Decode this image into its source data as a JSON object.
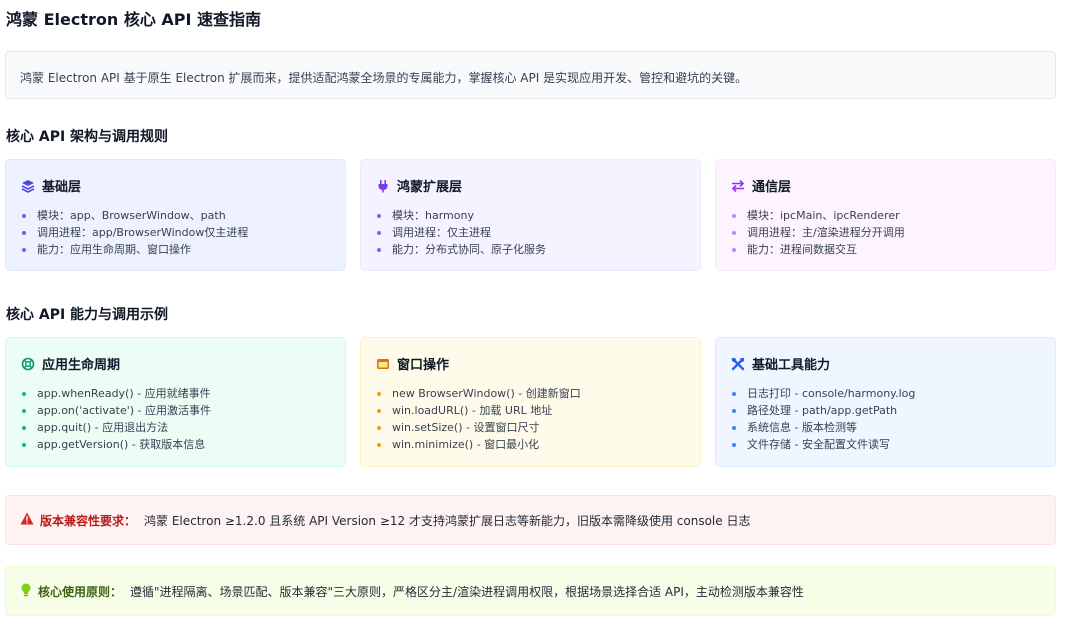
{
  "title": "鸿蒙 Electron 核心 API 速查指南",
  "intro": "鸿蒙 Electron API 基于原生 Electron 扩展而来，提供适配鸿蒙全场景的专属能力，掌握核心 API 是实现应用开发、管控和避坑的关键。",
  "sections": {
    "architecture": {
      "title": "核心 API 架构与调用规则",
      "cards": [
        {
          "title": "基础层",
          "icon": "layers-icon",
          "color": "#4f46e5",
          "items": [
            "模块：app、BrowserWindow、path",
            "调用进程：app/BrowserWindow仅主进程",
            "能力：应用生命周期、窗口操作"
          ]
        },
        {
          "title": "鸿蒙扩展层",
          "icon": "plug-icon",
          "color": "#7c3aed",
          "items": [
            "模块：harmony",
            "调用进程：仅主进程",
            "能力：分布式协同、原子化服务"
          ]
        },
        {
          "title": "通信层",
          "icon": "exchange-icon",
          "color": "#9333ea",
          "items": [
            "模块：ipcMain、ipcRenderer",
            "调用进程：主/渲染进程分开调用",
            "能力：进程间数据交互"
          ]
        }
      ]
    },
    "examples": {
      "title": "核心 API 能力与调用示例",
      "cards": [
        {
          "title": "应用生命周期",
          "icon": "lifecycle-icon",
          "color": "#059669",
          "items": [
            "app.whenReady() - 应用就绪事件",
            "app.on('activate') - 应用激活事件",
            "app.quit() - 应用退出方法",
            "app.getVersion() - 获取版本信息"
          ]
        },
        {
          "title": "窗口操作",
          "icon": "window-icon",
          "color": "#d97706",
          "items": [
            "new BrowserWindow() - 创建新窗口",
            "win.loadURL() - 加载 URL 地址",
            "win.setSize() - 设置窗口尺寸",
            "win.minimize() - 窗口最小化"
          ]
        },
        {
          "title": "基础工具能力",
          "icon": "tools-icon",
          "color": "#2563eb",
          "items": [
            "日志打印 - console/harmony.log",
            "路径处理 - path/app.getPath",
            "系统信息 - 版本检测等",
            "文件存储 - 安全配置文件读写"
          ]
        }
      ]
    }
  },
  "alerts": {
    "compat": {
      "label": "版本兼容性要求：",
      "text": "鸿蒙 Electron ≥1.2.0 且系统 API Version ≥12 才支持鸿蒙扩展日志等新能力，旧版本需降级使用 console 日志",
      "icon": "warning-icon",
      "color": "#dc2626"
    },
    "principle": {
      "label": "核心使用原则：",
      "text": "遵循\"进程隔离、场景匹配、版本兼容\"三大原则，严格区分主/渲染进程调用权限，根据场景选择合适 API，主动检测版本兼容性",
      "icon": "lightbulb-icon",
      "color": "#65a30d"
    }
  }
}
